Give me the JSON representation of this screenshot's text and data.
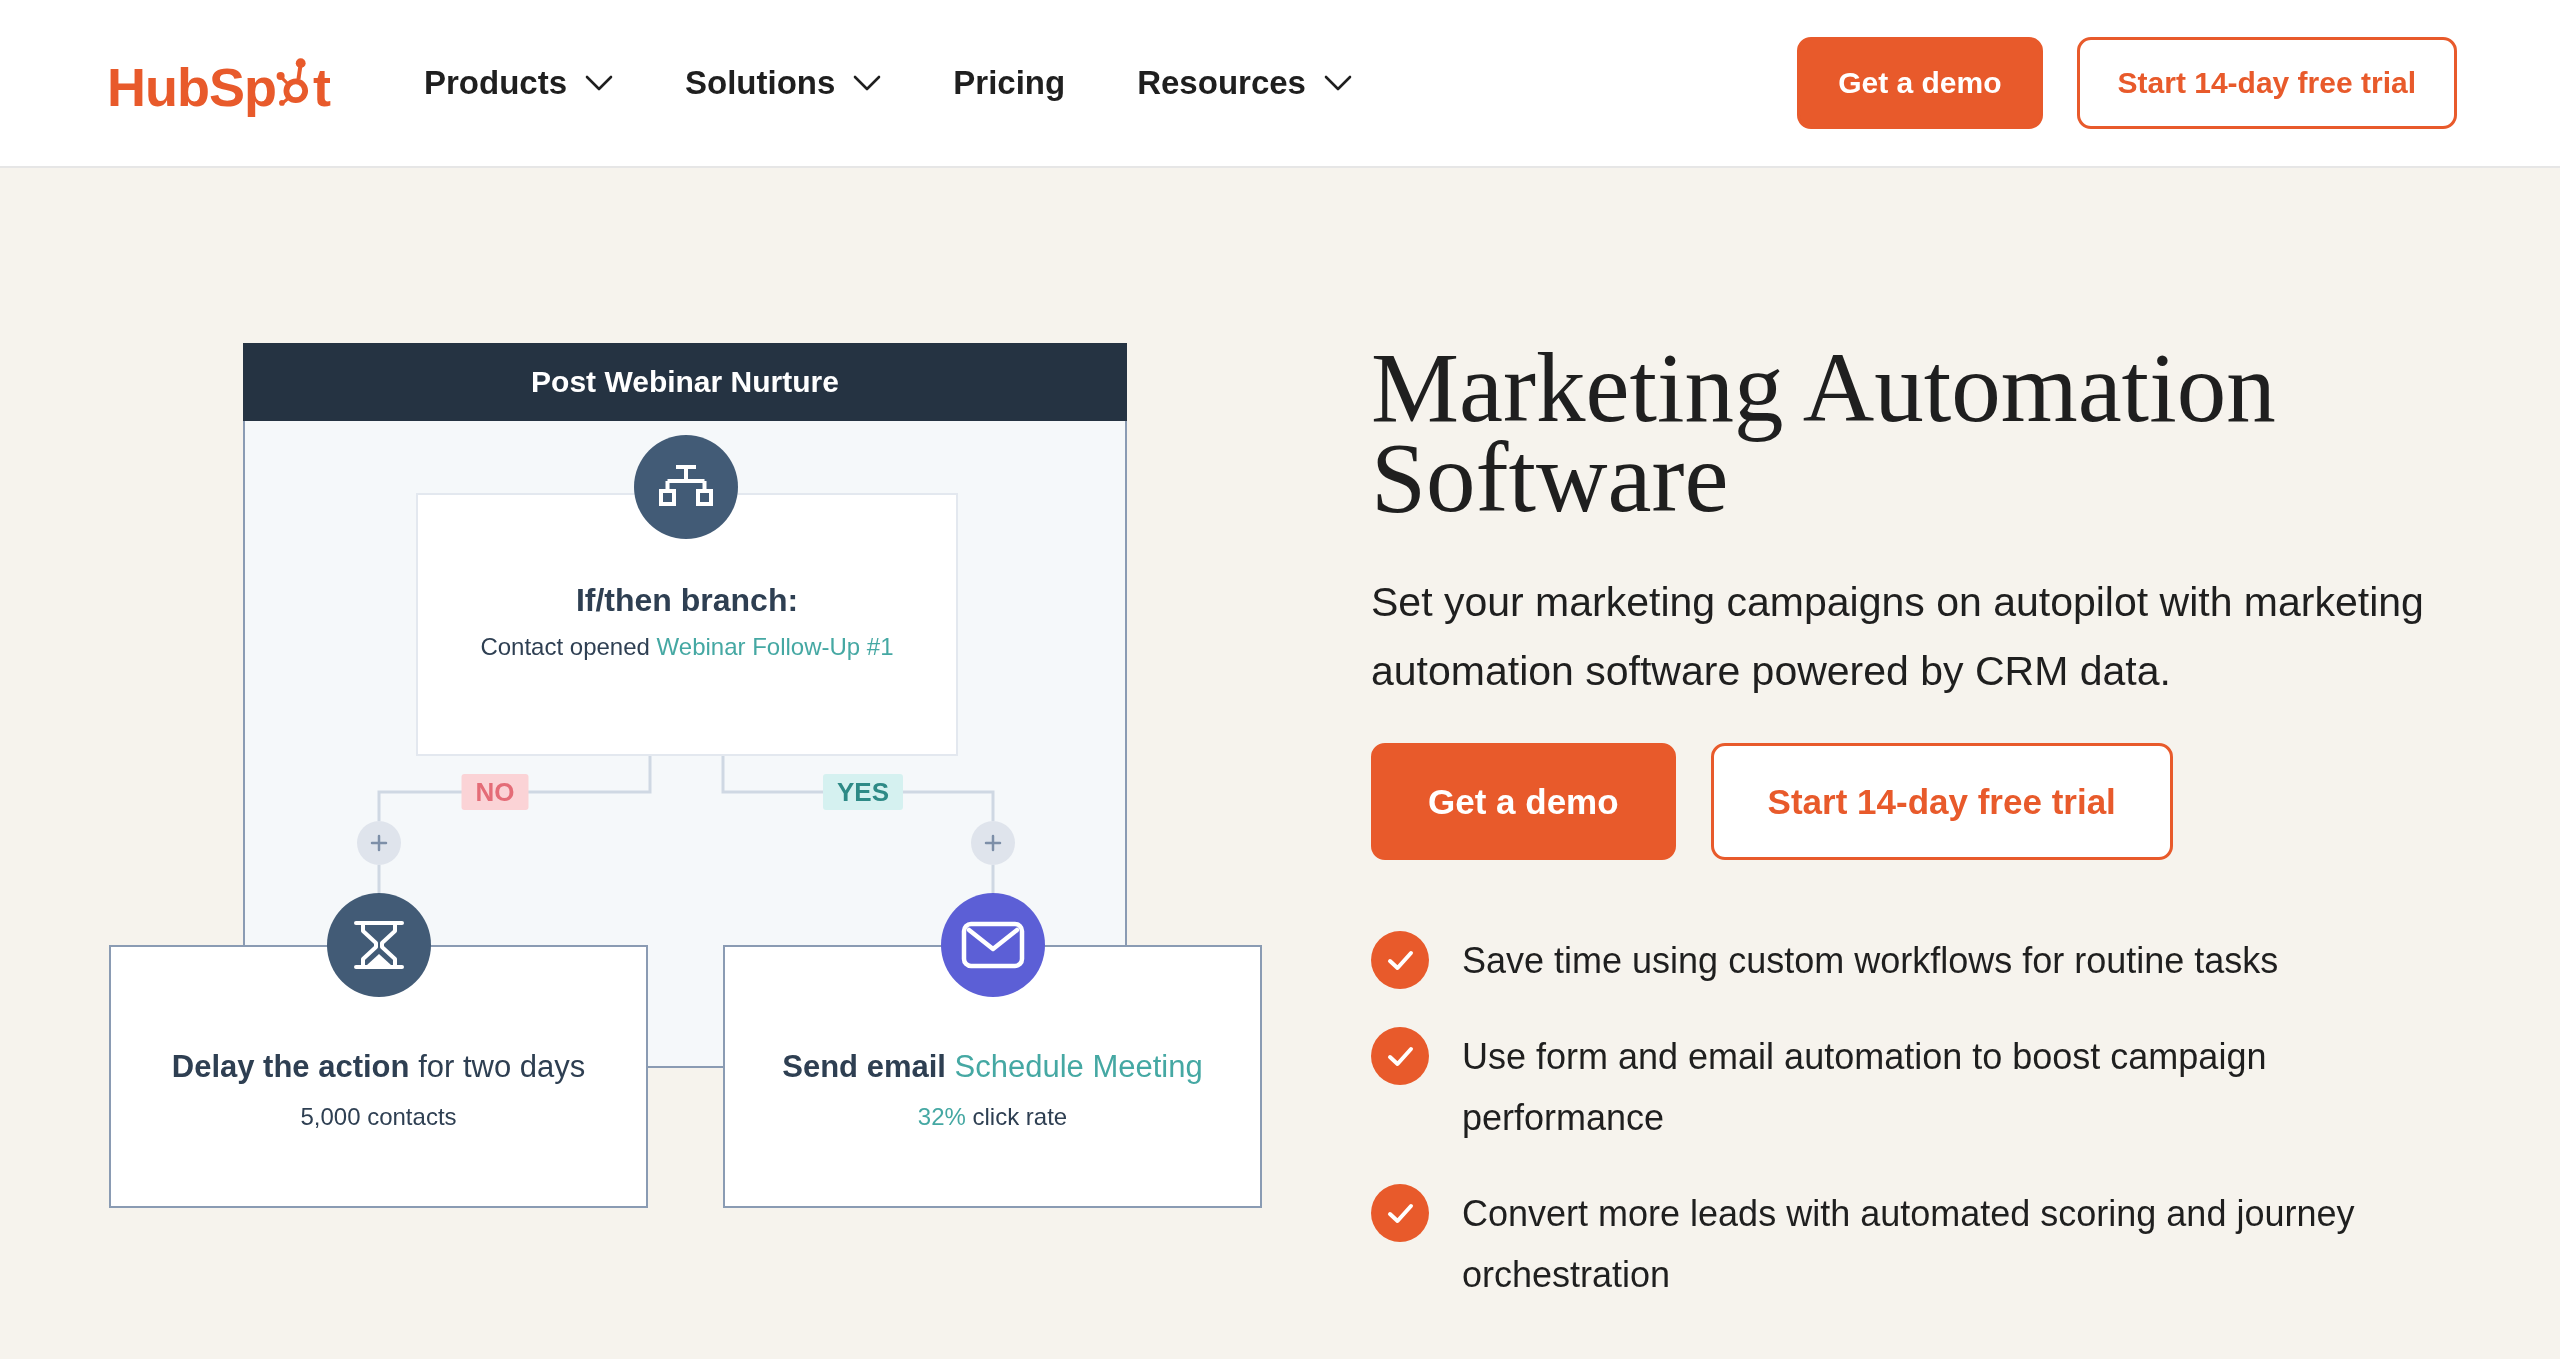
{
  "header": {
    "logo": {
      "before_icon": "HubSp",
      "after_icon": "t"
    },
    "nav": [
      {
        "label": "Products",
        "dropdown": true
      },
      {
        "label": "Solutions",
        "dropdown": true
      },
      {
        "label": "Pricing",
        "dropdown": false
      },
      {
        "label": "Resources",
        "dropdown": true
      }
    ],
    "buttons": [
      {
        "label": "Get a demo",
        "kind": "primary"
      },
      {
        "label": "Start 14-day free trial",
        "kind": "outline"
      }
    ]
  },
  "workflow": {
    "title": "Post Webinar Nurture",
    "branch": {
      "title": "If/then branch:",
      "condition": [
        {
          "kind": "plain",
          "text": "Contact opened"
        },
        {
          "kind": "accent",
          "text": "Webinar Follow-Up #1"
        }
      ]
    },
    "branch_labels": [
      {
        "text": "NO",
        "kind": "no"
      },
      {
        "text": "YES",
        "kind": "yes"
      }
    ],
    "actions": [
      {
        "kind": "delay",
        "title": [
          {
            "kind": "strong",
            "text": "Delay the action"
          },
          {
            "kind": "plain",
            "text": "for two days"
          }
        ],
        "detail": [
          {
            "kind": "plain",
            "text": "5,000 contacts"
          }
        ]
      },
      {
        "kind": "email",
        "title": [
          {
            "kind": "strong",
            "text": "Send email"
          },
          {
            "kind": "accent",
            "text": "Schedule Meeting"
          }
        ],
        "detail": [
          {
            "kind": "accent",
            "text": "32%"
          },
          {
            "kind": "plain",
            "text": "click rate"
          }
        ]
      }
    ]
  },
  "hero": {
    "title": "Marketing Automation Software",
    "description": "Set your marketing campaigns on autopilot with marketing automation software powered by CRM data.",
    "buttons": [
      {
        "label": "Get a demo",
        "kind": "primary"
      },
      {
        "label": "Start 14-day free trial",
        "kind": "outline"
      }
    ],
    "benefits": [
      "Save time using custom workflows for routine tasks",
      "Use form and email automation to boost campaign performance",
      "Convert more leads with automated scoring and journey orchestration"
    ]
  }
}
